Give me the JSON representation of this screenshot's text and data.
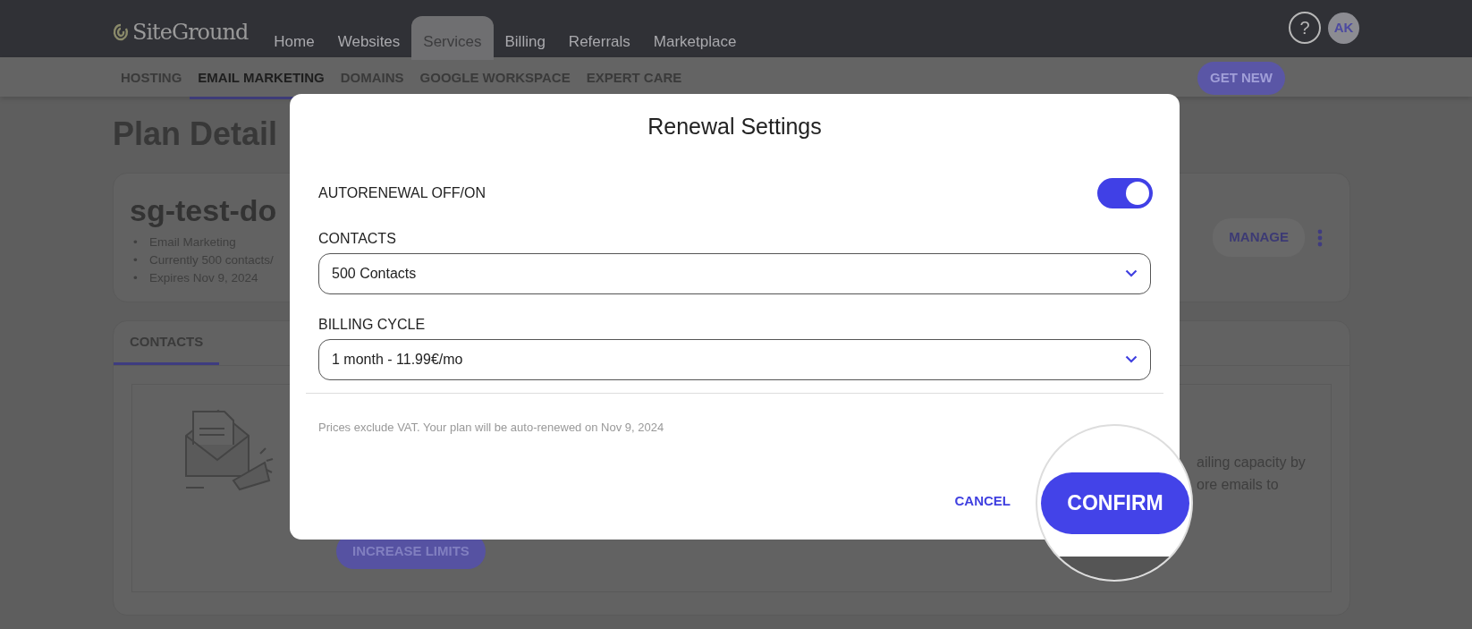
{
  "header": {
    "logo": "SiteGround",
    "nav": [
      {
        "label": "Home",
        "selected": false
      },
      {
        "label": "Websites",
        "selected": false
      },
      {
        "label": "Services",
        "selected": true
      },
      {
        "label": "Billing",
        "selected": false
      },
      {
        "label": "Referrals",
        "selected": false
      },
      {
        "label": "Marketplace",
        "selected": false
      }
    ],
    "help": "?",
    "avatar": "AK"
  },
  "subnav": {
    "tabs": [
      {
        "label": "HOSTING",
        "selected": false
      },
      {
        "label": "EMAIL MARKETING",
        "selected": true
      },
      {
        "label": "DOMAINS",
        "selected": false
      },
      {
        "label": "GOOGLE WORKSPACE",
        "selected": false
      },
      {
        "label": "EXPERT CARE",
        "selected": false
      }
    ],
    "get_new": "GET NEW"
  },
  "page": {
    "title": "Plan Detail",
    "plan": {
      "name": "sg-test-do",
      "bullet": "•",
      "details": [
        "Email Marketing",
        "Currently 500 contacts/",
        "Expires Nov 9, 2024"
      ],
      "manage": "MANAGE"
    },
    "tabs": [
      {
        "label": "CONTACTS",
        "selected": true
      }
    ],
    "upgrade": {
      "lines": [
        "ailing capacity by",
        "ore emails to"
      ],
      "button": "INCREASE LIMITS"
    }
  },
  "dialog": {
    "title": "Renewal Settings",
    "autorenew": {
      "label": "AUTORENEWAL OFF/ON",
      "on": true
    },
    "fields": [
      {
        "label": "CONTACTS",
        "value": "500 Contacts"
      },
      {
        "label": "BILLING CYCLE",
        "value": "1 month - 11.99€/mo"
      }
    ],
    "note": "Prices exclude VAT. Your plan will be auto-renewed on Nov 9, 2024",
    "cancel": "CANCEL",
    "confirm": "CONFIRM"
  }
}
